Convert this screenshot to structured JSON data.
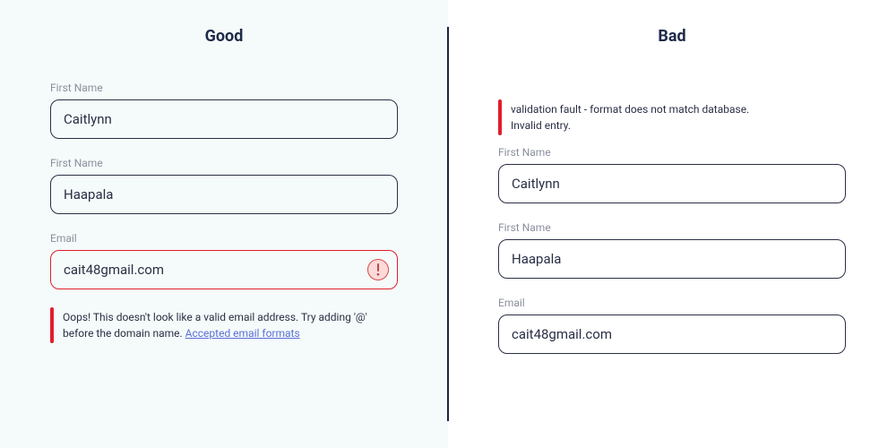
{
  "good": {
    "title": "Good",
    "fields": {
      "first_name": {
        "label": "First Name",
        "value": "Caitlynn"
      },
      "last_name": {
        "label": "First Name",
        "value": "Haapala"
      },
      "email": {
        "label": "Email",
        "value": "cait48gmail.com"
      }
    },
    "error": {
      "text": "Oops! This doesn't look like a valid email address. Try adding '@' before the domain name. ",
      "link": "Accepted email formats"
    }
  },
  "bad": {
    "title": "Bad",
    "error": {
      "line1": "validation fault - format does not match database.",
      "line2": "Invalid entry."
    },
    "fields": {
      "first_name": {
        "label": "First Name",
        "value": "Caitlynn"
      },
      "last_name": {
        "label": "First Name",
        "value": "Haapala"
      },
      "email": {
        "label": "Email",
        "value": "cait48gmail.com"
      }
    }
  }
}
